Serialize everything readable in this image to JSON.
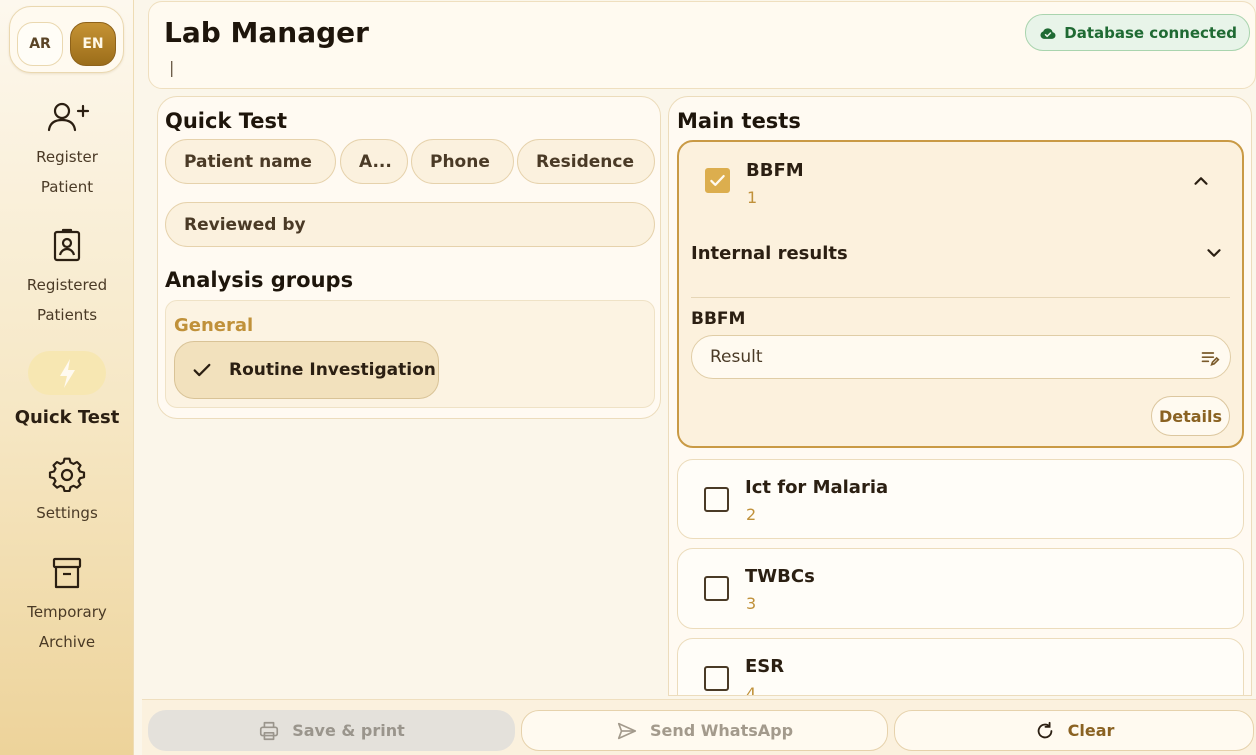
{
  "sidebar": {
    "languages": [
      "AR",
      "EN"
    ],
    "active_language": "EN",
    "items": [
      {
        "label": "Register Patient",
        "icon": "add-person-icon"
      },
      {
        "label": "Registered Patients",
        "icon": "id-badge-icon"
      },
      {
        "label": "Quick Test",
        "icon": "lightning-icon",
        "active": true
      },
      {
        "label": "Settings",
        "icon": "gear-icon"
      },
      {
        "label": "Temporary Archive",
        "icon": "archive-box-icon"
      }
    ]
  },
  "header": {
    "title": "Lab Manager",
    "caret": "|",
    "db_status": "Database connected",
    "db_status_color": "#1f6a33"
  },
  "quick_test": {
    "title": "Quick Test",
    "fields": {
      "patient_name": "Patient name",
      "age": "A...",
      "phone": "Phone",
      "residence": "Residence",
      "reviewed_by": "Reviewed by"
    },
    "analysis_groups_title": "Analysis groups",
    "group": {
      "name": "General",
      "chip": "Routine Investigation",
      "chip_selected": true
    }
  },
  "main_tests": {
    "title": "Main tests",
    "tests": [
      {
        "name": "BBFM",
        "number": "1",
        "checked": true,
        "expanded": true,
        "internal_results_label": "Internal results",
        "result_label": "BBFM",
        "result_placeholder": "Result",
        "details_label": "Details"
      },
      {
        "name": "Ict for Malaria",
        "number": "2",
        "checked": false
      },
      {
        "name": "TWBCs",
        "number": "3",
        "checked": false
      },
      {
        "name": "ESR",
        "number": "4",
        "checked": false
      }
    ]
  },
  "bottom": {
    "save_print": "Save & print",
    "send_whatsapp": "Send WhatsApp",
    "clear": "Clear"
  },
  "colors": {
    "accent": "#c0913a",
    "checked": "#dcae4e",
    "brand_button": "#9b6d1a"
  }
}
